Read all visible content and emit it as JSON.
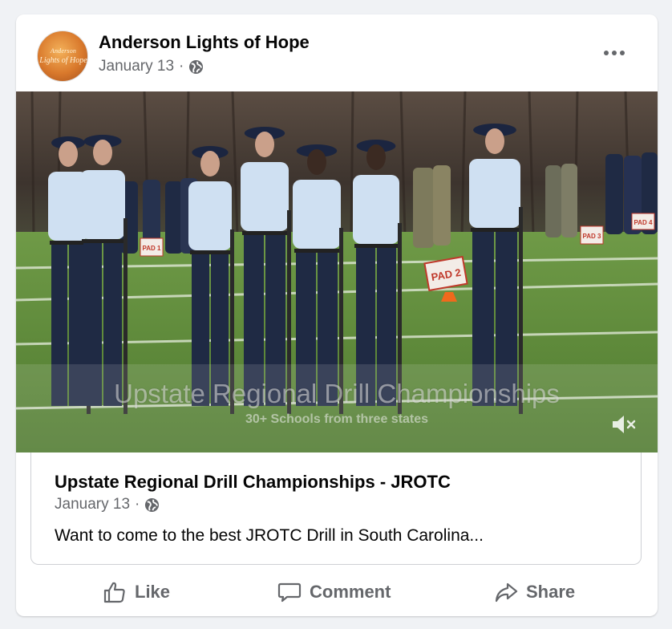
{
  "post": {
    "author": "Anderson Lights of Hope",
    "avatar_text_line1": "Anderson",
    "avatar_text_line2": "Lights of Hope",
    "date": "January 13",
    "separator": "·",
    "privacy_icon": "globe-icon",
    "more_icon": "more-options-icon"
  },
  "media": {
    "overlay_title": "Upstate Regional Drill Championships",
    "overlay_subtitle": "30+ Schools from three states",
    "field_sign_label": "PAD 2",
    "small_sign_1": "PAD 1",
    "small_sign_2": "PAD 3",
    "small_sign_3": "PAD 4",
    "mute_icon": "muted-speaker-icon"
  },
  "link": {
    "title": "Upstate Regional Drill Championships - JROTC",
    "date": "January 13",
    "separator": "·",
    "description": "Want to come to the best JROTC Drill in South Carolina..."
  },
  "actions": {
    "like_label": "Like",
    "comment_label": "Comment",
    "share_label": "Share"
  },
  "colors": {
    "background": "#f0f2f5",
    "card": "#ffffff",
    "secondary_text": "#65676b",
    "primary_text": "#050505",
    "field_green": "#5f8a3a",
    "uniform_blue": "#1f2a44",
    "shirt_blue": "#cfe0f2"
  }
}
